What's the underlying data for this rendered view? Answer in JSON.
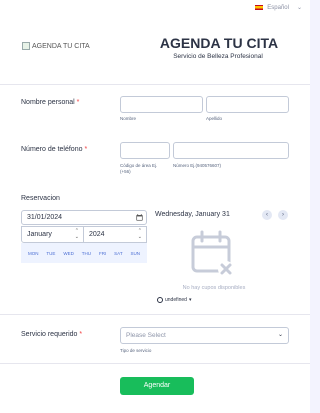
{
  "language": {
    "selected": "Español"
  },
  "header": {
    "logo_alt": "AGENDA TU CITA",
    "title": "AGENDA TU CITA",
    "subtitle": "Servicio de Belleza Profesional"
  },
  "name_field": {
    "label": "Nombre personal",
    "required_mark": "*",
    "first_sublabel": "Nombre",
    "last_sublabel": "Apellido"
  },
  "phone_field": {
    "label": "Número de teléfono",
    "required_mark": "*",
    "area_sublabel_1": "Código de área Ej.",
    "area_sublabel_2": "(+56)",
    "number_sublabel": "Número Ej.(940576607)"
  },
  "reservation": {
    "label": "Reservacion",
    "date_value": "31/01/2024",
    "month": "January",
    "year": "2024",
    "weekdays": [
      "MON",
      "TUE",
      "WED",
      "THU",
      "FRI",
      "SAT",
      "SUN"
    ],
    "slot_date": "Wednesday, January 31",
    "no_slots": "No hay cupos disponibles",
    "timezone": "undefined"
  },
  "service_field": {
    "label": "Servicio requerido",
    "required_mark": "*",
    "placeholder": "Please Select",
    "sublabel": "Tipo de servicio"
  },
  "submit": {
    "label": "Agendar"
  },
  "colors": {
    "accent": "#18bd5b",
    "required": "#f23a3c",
    "calendar_bg": "#eef3ff"
  },
  "icons": {
    "flag": "spain-flag-icon",
    "calendar": "calendar-icon",
    "empty_calendar": "calendar-x-icon",
    "clock": "clock-icon",
    "prev": "chevron-left-icon",
    "next": "chevron-right-icon",
    "dropdown": "chevron-down-icon"
  }
}
